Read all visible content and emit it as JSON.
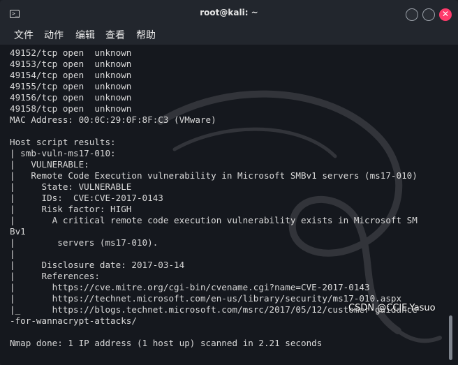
{
  "window": {
    "title": "root@kali: ~"
  },
  "menu": {
    "items": [
      "文件",
      "动作",
      "编辑",
      "查看",
      "帮助"
    ]
  },
  "terminal": {
    "lines": [
      "49152/tcp open  unknown",
      "49153/tcp open  unknown",
      "49154/tcp open  unknown",
      "49155/tcp open  unknown",
      "49156/tcp open  unknown",
      "49158/tcp open  unknown",
      "MAC Address: 00:0C:29:0F:8F:C3 (VMware)",
      "",
      "Host script results:",
      "| smb-vuln-ms17-010:",
      "|   VULNERABLE:",
      "|   Remote Code Execution vulnerability in Microsoft SMBv1 servers (ms17-010)",
      "|     State: VULNERABLE",
      "|     IDs:  CVE:CVE-2017-0143",
      "|     Risk factor: HIGH",
      "|       A critical remote code execution vulnerability exists in Microsoft SM",
      "Bv1",
      "|        servers (ms17-010).",
      "|",
      "|     Disclosure date: 2017-03-14",
      "|     References:",
      "|       https://cve.mitre.org/cgi-bin/cvename.cgi?name=CVE-2017-0143",
      "|       https://technet.microsoft.com/en-us/library/security/ms17-010.aspx",
      "|_      https://blogs.technet.microsoft.com/msrc/2017/05/12/customer-guidance",
      "-for-wannacrypt-attacks/",
      "",
      "Nmap done: 1 IP address (1 host up) scanned in 2.21 seconds"
    ]
  },
  "watermark": "CSDN @CCIE-Yasuo",
  "colors": {
    "terminal_bg": "#15181e",
    "titlebar_bg": "#22262d",
    "text": "#d9d9d9",
    "close_button": "#ff3b6b"
  }
}
